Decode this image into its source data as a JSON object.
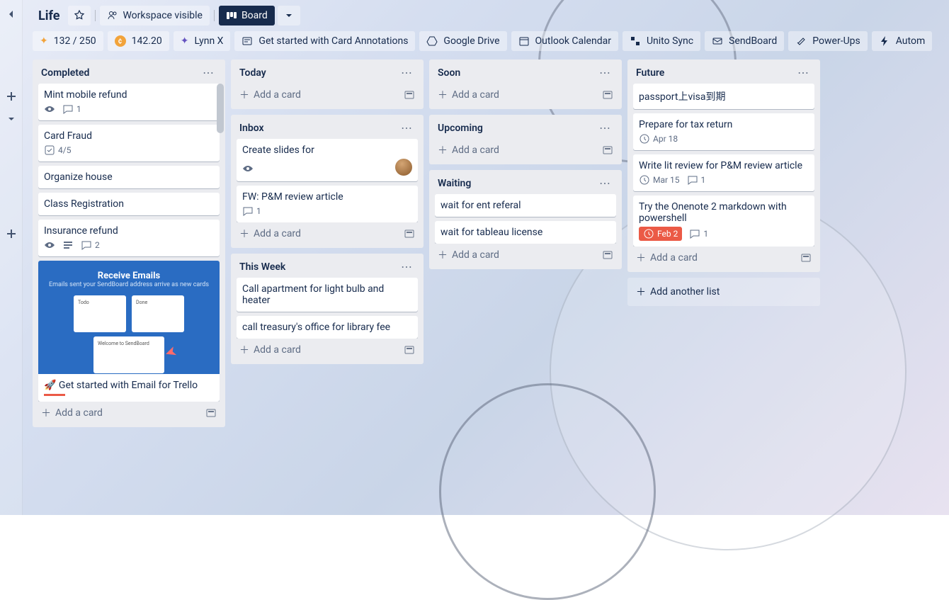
{
  "board_name": "Life",
  "header": {
    "workspace": "Workspace visible",
    "view": "Board"
  },
  "toolbar": {
    "points": "132 / 250",
    "credits": "142.20",
    "butler": "Lynn X",
    "items": [
      "Get started with Card Annotations",
      "Google Drive",
      "Outlook Calendar",
      "Unito Sync",
      "SendBoard",
      "Power-Ups",
      "Autom"
    ]
  },
  "addCardLabel": "Add a card",
  "addListLabel": "Add another list",
  "lists": {
    "completed": {
      "title": "Completed",
      "cards": [
        {
          "t": "Mint mobile refund",
          "watch": true,
          "comments": "1"
        },
        {
          "t": "Card Fraud",
          "check": "4/5"
        },
        {
          "t": "Organize house"
        },
        {
          "t": "Class Registration"
        },
        {
          "t": "Insurance refund",
          "watch": true,
          "desc": true,
          "comments": "2"
        },
        {
          "t": "🚀 Get started with Email for Trello",
          "cover": true
        }
      ]
    },
    "today": {
      "title": "Today",
      "cards": []
    },
    "inbox": {
      "title": "Inbox",
      "cards": [
        {
          "t": "Create slides for",
          "watch": true,
          "avatar": true
        },
        {
          "t": "FW: P&M review article",
          "comments": "1"
        }
      ]
    },
    "thisweek": {
      "title": "This Week",
      "cards": [
        {
          "t": "Call apartment for light bulb and heater"
        },
        {
          "t": "call treasury's office for library fee"
        }
      ]
    },
    "soon": {
      "title": "Soon",
      "cards": []
    },
    "upcoming": {
      "title": "Upcoming",
      "cards": []
    },
    "waiting": {
      "title": "Waiting",
      "cards": [
        {
          "t": "wait for ent referal"
        },
        {
          "t": "wait for tableau license"
        }
      ]
    },
    "future": {
      "title": "Future",
      "cards": [
        {
          "t": "passport上visa到期"
        },
        {
          "t": "Prepare for tax return",
          "due": "Apr 18"
        },
        {
          "t": "Write lit review for P&M review article",
          "due": "Mar 15",
          "comments": "1"
        },
        {
          "t": "Try the Onenote 2 markdown with powershell",
          "dueOver": "Feb 2",
          "comments": "1"
        }
      ]
    }
  },
  "cover": {
    "h": "Receive Emails",
    "sub": "Emails sent your SendBoard address arrive as new cards",
    "c1": "Todo",
    "c2": "Done",
    "c3": "Welcome to SendBoard"
  }
}
